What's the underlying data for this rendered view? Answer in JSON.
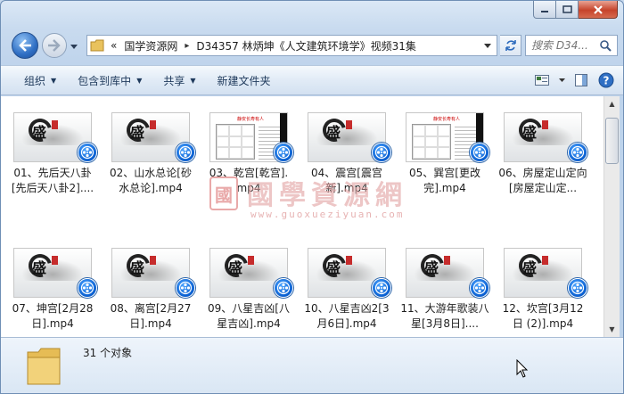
{
  "window": {
    "address": {
      "overflow": "«",
      "segments": [
        "国学资源网",
        "D34357 林炳坤《人文建筑环境学》视频31集"
      ]
    },
    "search": {
      "placeholder": "搜索 D34..."
    }
  },
  "commandbar": {
    "organize": "组织",
    "include": "包含到库中",
    "share": "共享",
    "new_folder": "新建文件夹"
  },
  "files": [
    {
      "label": "01、先后天八卦[先后天八卦2]....",
      "thumb": "logo"
    },
    {
      "label": "02、山水总论[砂水总论].mp4",
      "thumb": "logo"
    },
    {
      "label": "03、乾宫[乾宫].mp4",
      "thumb": "doc"
    },
    {
      "label": "04、震宫[震宫新].mp4",
      "thumb": "logo"
    },
    {
      "label": "05、巽宫[更改完].mp4",
      "thumb": "doc"
    },
    {
      "label": "06、房屋定山定向[房屋定山定...",
      "thumb": "logo"
    },
    {
      "label": "07、坤宫[2月28日].mp4",
      "thumb": "logo"
    },
    {
      "label": "08、离宫[2月27日].mp4",
      "thumb": "logo"
    },
    {
      "label": "09、八星吉凶[八星吉凶].mp4",
      "thumb": "logo"
    },
    {
      "label": "10、八星吉凶2[3月6日].mp4",
      "thumb": "logo"
    },
    {
      "label": "11、大游年歌装八星[3月8日]....",
      "thumb": "logo"
    },
    {
      "label": "12、坎宫[3月12日 (2)].mp4",
      "thumb": "logo"
    }
  ],
  "thumb_text": {
    "logo_char": "盛",
    "doc_header": "静安长寿有人"
  },
  "watermark": {
    "seal": "國",
    "title": "國學資源網",
    "url": "www.guoxueziyuan.com"
  },
  "details": {
    "count": "31 个对象"
  },
  "colors": {
    "accent": "#1e395b",
    "badge": "#0a5fd0",
    "seal": "#c62c2c"
  }
}
